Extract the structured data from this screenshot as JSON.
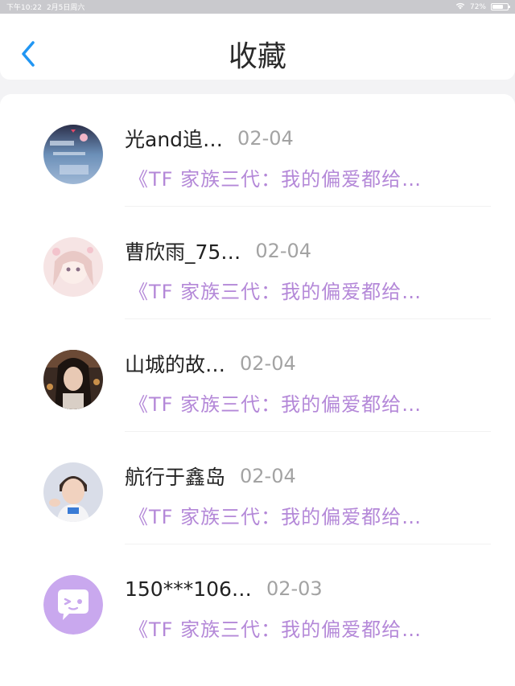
{
  "status_bar": {
    "time": "下午10:22",
    "date": "2月5日周六",
    "battery": "72%",
    "battery_level": 0.72
  },
  "header": {
    "back_icon": "chevron-left-icon",
    "title": "收藏"
  },
  "colors": {
    "accent": "#2196f3",
    "snippet": "#b488d8",
    "date": "#a3a3a3",
    "default_avatar_bg": "#c9a8ee"
  },
  "items": [
    {
      "name": "光and追…",
      "date": "02-04",
      "snippet": "《TF 家族三代：我的偏爱都给…",
      "avatar": "photo-avatar"
    },
    {
      "name": "曹欣雨_75…",
      "date": "02-04",
      "snippet": "《TF 家族三代：我的偏爱都给…",
      "avatar": "photo-avatar"
    },
    {
      "name": "山城的故…",
      "date": "02-04",
      "snippet": "《TF 家族三代：我的偏爱都给…",
      "avatar": "photo-avatar"
    },
    {
      "name": "航行于鑫岛",
      "date": "02-04",
      "snippet": "《TF 家族三代：我的偏爱都给…",
      "avatar": "photo-avatar"
    },
    {
      "name": "150***106…",
      "date": "02-03",
      "snippet": "《TF 家族三代：我的偏爱都给…",
      "avatar": "default-chat-avatar-icon"
    }
  ]
}
